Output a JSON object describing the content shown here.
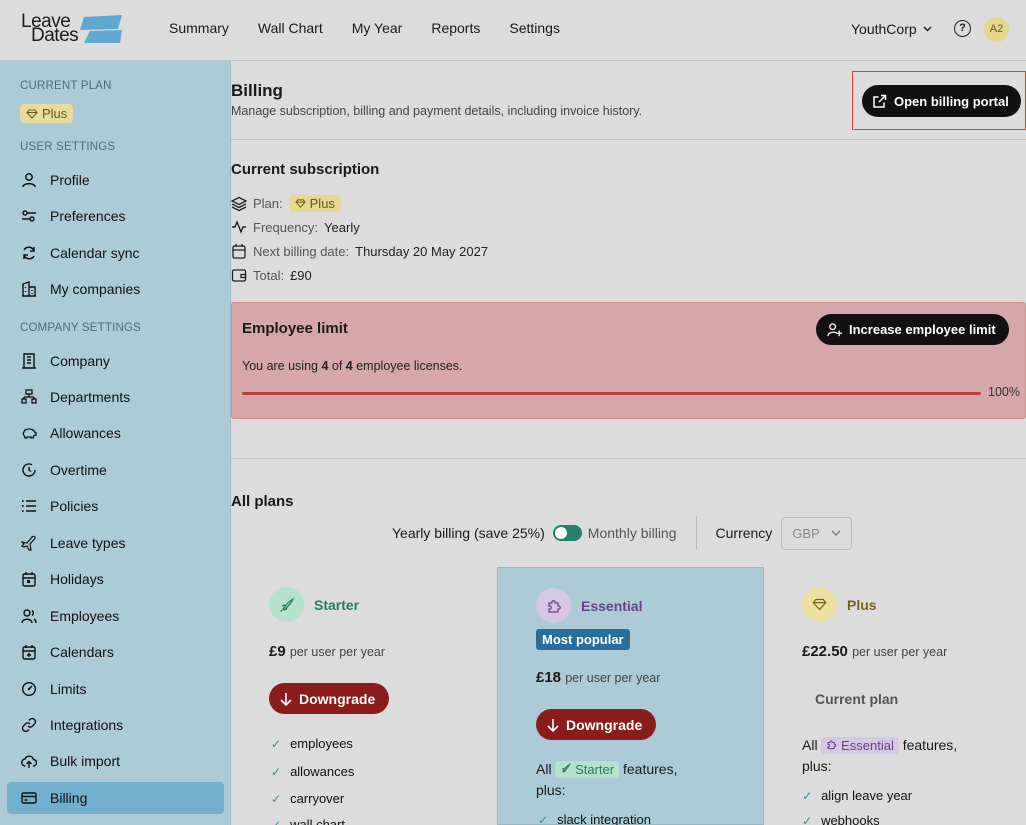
{
  "logo": {
    "line1": "Leave",
    "line2": "Dates"
  },
  "nav": [
    "Summary",
    "Wall Chart",
    "My Year",
    "Reports",
    "Settings"
  ],
  "company": "YouthCorp",
  "help_symbol": "?",
  "avatar": "A2",
  "sidebar": {
    "current_plan_label": "CURRENT PLAN",
    "current_plan": "Plus",
    "user_settings_label": "USER SETTINGS",
    "user_items": [
      {
        "label": "Profile",
        "icon": "user-icon"
      },
      {
        "label": "Preferences",
        "icon": "sliders-icon"
      },
      {
        "label": "Calendar sync",
        "icon": "sync-icon"
      },
      {
        "label": "My companies",
        "icon": "buildings-icon"
      }
    ],
    "company_settings_label": "COMPANY SETTINGS",
    "company_items": [
      {
        "label": "Company",
        "icon": "building-icon"
      },
      {
        "label": "Departments",
        "icon": "org-chart-icon"
      },
      {
        "label": "Allowances",
        "icon": "piggy-bank-icon"
      },
      {
        "label": "Overtime",
        "icon": "clock-icon"
      },
      {
        "label": "Policies",
        "icon": "list-icon"
      },
      {
        "label": "Leave types",
        "icon": "plane-icon"
      },
      {
        "label": "Holidays",
        "icon": "calendar-icon"
      },
      {
        "label": "Employees",
        "icon": "users-icon"
      },
      {
        "label": "Calendars",
        "icon": "calendar-plus-icon"
      },
      {
        "label": "Limits",
        "icon": "gauge-icon"
      },
      {
        "label": "Integrations",
        "icon": "link-icon"
      },
      {
        "label": "Bulk import",
        "icon": "upload-cloud-icon"
      },
      {
        "label": "Billing",
        "icon": "credit-card-icon",
        "active": true
      }
    ]
  },
  "billing": {
    "title": "Billing",
    "subtitle": "Manage subscription, billing and payment details, including invoice history.",
    "portal_button": "Open billing portal"
  },
  "subscription": {
    "title": "Current subscription",
    "plan_label": "Plan:",
    "plan_value": "Plus",
    "frequency_label": "Frequency:",
    "frequency_value": "Yearly",
    "next_billing_label": "Next billing date:",
    "next_billing_value": "Thursday 20 May 2027",
    "total_label": "Total:",
    "total_value": "£90"
  },
  "employee_limit": {
    "title": "Employee limit",
    "button": "Increase employee limit",
    "text_prefix": "You are using ",
    "used": "4",
    "text_mid": " of ",
    "total": "4",
    "text_suffix": " employee licenses.",
    "percent_label": "100%",
    "progress": 1.0
  },
  "plans_section": {
    "title": "All plans",
    "yearly_label": "Yearly billing (save 25%)",
    "monthly_label": "Monthly billing",
    "currency_label": "Currency",
    "currency_value": "GBP"
  },
  "plans": [
    {
      "name": "Starter",
      "price": "£9",
      "per": "per user per year",
      "button": "Downgrade",
      "features": [
        "employees",
        "allowances",
        "carryover",
        "wall chart"
      ]
    },
    {
      "name": "Essential",
      "badge": "Most popular",
      "price": "£18",
      "per": "per user per year",
      "button": "Downgrade",
      "all_prefix": "All",
      "all_tag": "Starter",
      "all_suffix": "features,",
      "all_plus": "plus:",
      "features": [
        "slack integration"
      ]
    },
    {
      "name": "Plus",
      "price": "£22.50",
      "per": "per user per year",
      "current_label": "Current plan",
      "all_prefix": "All",
      "all_tag": "Essential",
      "all_suffix": "features,",
      "all_plus": "plus:",
      "features": [
        "align leave year",
        "webhooks"
      ]
    }
  ],
  "colors": {
    "sidebar_bg": "#adcbd6",
    "active_item": "#72afcc",
    "plus_pill": "#e6d793",
    "limit_bg": "#d6a7a8",
    "downgrade": "#8b1c1c",
    "popular_badge": "#2a6e9b"
  }
}
